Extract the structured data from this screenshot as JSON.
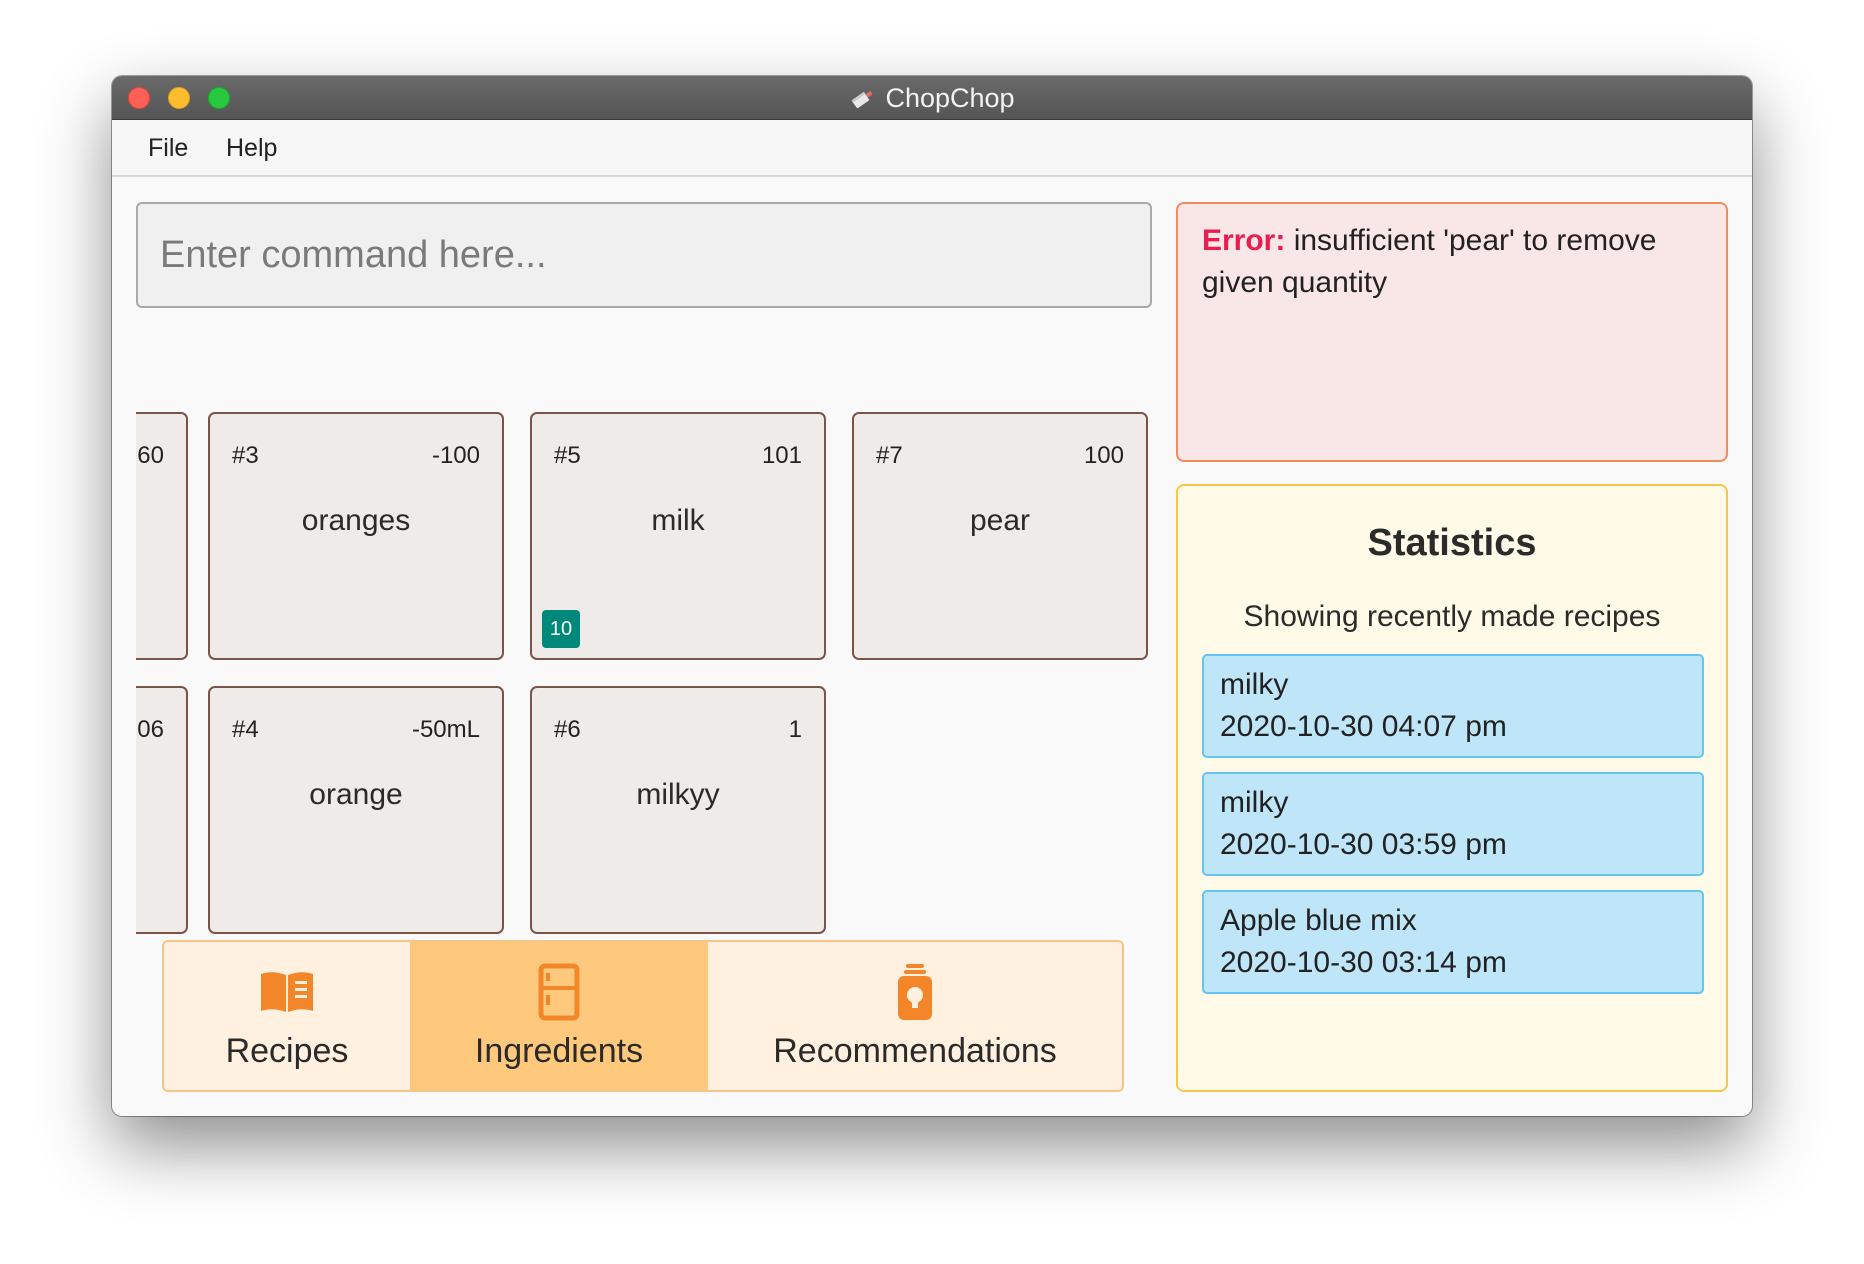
{
  "window": {
    "title": "ChopChop"
  },
  "menu": {
    "file": "File",
    "help": "Help"
  },
  "command": {
    "placeholder": "Enter command here..."
  },
  "ingredients": [
    {
      "index": "",
      "qty": "60",
      "name": "",
      "partial": true
    },
    {
      "index": "#3",
      "qty": "-100",
      "name": "oranges"
    },
    {
      "index": "#5",
      "qty": "101",
      "name": "milk",
      "badge": "10"
    },
    {
      "index": "#7",
      "qty": "100",
      "name": "pear"
    },
    {
      "index": "",
      "qty": "06",
      "name": "",
      "partial": true
    },
    {
      "index": "#4",
      "qty": "-50mL",
      "name": "orange"
    },
    {
      "index": "#6",
      "qty": "1",
      "name": "milkyy"
    }
  ],
  "tabs": [
    {
      "label": "Recipes",
      "icon": "book-icon",
      "active": false
    },
    {
      "label": "Ingredients",
      "icon": "fridge-icon",
      "active": true
    },
    {
      "label": "Recommendations",
      "icon": "lightbulb-jar-icon",
      "active": false
    }
  ],
  "error": {
    "label": "Error:",
    "message": " insufficient 'pear' to remove given quantity"
  },
  "stats": {
    "title": "Statistics",
    "subtitle": "Showing recently made recipes",
    "items": [
      {
        "name": "milky",
        "time": "2020-10-30 04:07 pm"
      },
      {
        "name": "milky",
        "time": "2020-10-30 03:59 pm"
      },
      {
        "name": "Apple blue mix",
        "time": "2020-10-30 03:14 pm"
      }
    ]
  },
  "colors": {
    "card_border": "#7a5449",
    "badge": "#00897b",
    "tab_active": "#fec97d",
    "tab_bg": "#fff0df",
    "accent_orange": "#f4862a",
    "error_label": "#ea1e4e",
    "stat_item": "#bfe5f8"
  }
}
